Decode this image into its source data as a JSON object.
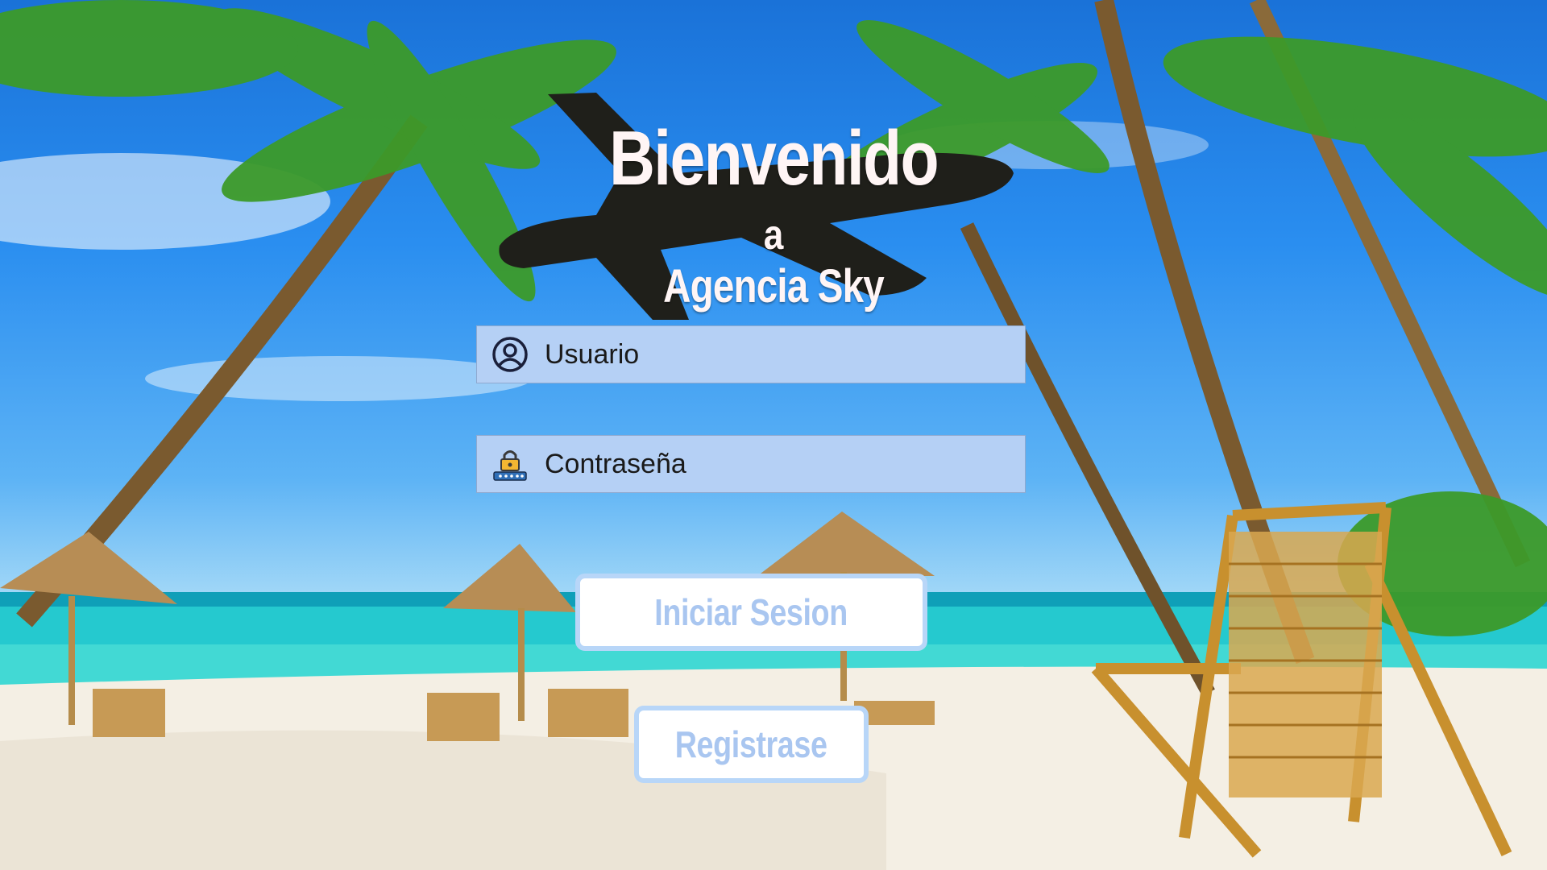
{
  "title": {
    "line1": "Bienvenido",
    "line2": "a",
    "line3": "Agencia Sky"
  },
  "form": {
    "username_placeholder": "Usuario",
    "password_placeholder": "Contraseña",
    "login_label": "Iniciar Sesion",
    "register_label": "Registrase"
  },
  "icons": {
    "username": "user-circle-icon",
    "password": "padlock-password-icon",
    "decoration": "airplane-silhouette"
  },
  "colors": {
    "field_bg": "#b5d0f5",
    "button_text": "#a9c6f0",
    "button_border": "#b8d6f8",
    "title_text": "#fff5f5",
    "plane": "#1f1f1a"
  }
}
